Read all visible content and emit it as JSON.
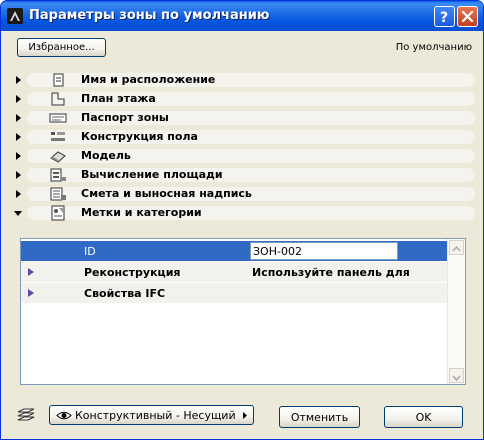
{
  "window": {
    "title": "Параметры зоны по умолчанию"
  },
  "toolbar": {
    "favorites_label": "Избранное...",
    "default_label": "По умолчанию"
  },
  "panels": [
    {
      "label": "Имя и расположение",
      "icon": "name-location-icon",
      "expanded": false
    },
    {
      "label": "План этажа",
      "icon": "floor-plan-icon",
      "expanded": false
    },
    {
      "label": "Паспорт зоны",
      "icon": "zone-stamp-icon",
      "expanded": false
    },
    {
      "label": "Конструкция пола",
      "icon": "floor-construction-icon",
      "expanded": false
    },
    {
      "label": "Модель",
      "icon": "model-icon",
      "expanded": false
    },
    {
      "label": "Вычисление площади",
      "icon": "area-calculation-icon",
      "expanded": false
    },
    {
      "label": "Смета и выносная надпись",
      "icon": "listing-label-icon",
      "expanded": false
    },
    {
      "label": "Метки и категории",
      "icon": "tags-categories-icon",
      "expanded": true
    }
  ],
  "grid": {
    "rows": [
      {
        "name": "ID",
        "value": "ЗОН-002",
        "selected": true,
        "expandable": false
      },
      {
        "name": "Реконструкция",
        "value": "Используйте панель для",
        "selected": false,
        "expandable": true
      },
      {
        "name": "Свойства IFC",
        "value": "",
        "selected": false,
        "expandable": true
      }
    ]
  },
  "footer": {
    "layer_combo_value": "Конструктивный - Несущий",
    "cancel_label": "Отменить",
    "ok_label": "OK"
  },
  "colors": {
    "title_bar": "#0554df",
    "selection": "#316ac5",
    "dialog_bg": "#ece9d8"
  }
}
